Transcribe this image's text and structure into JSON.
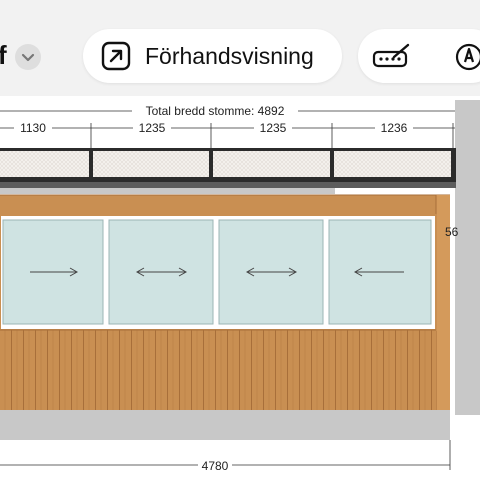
{
  "toolbar": {
    "file_name_fragment": "f",
    "preview_label": "Förhandsvisning"
  },
  "drawing": {
    "total_label": "Total bredd stomme: 4892",
    "segments": [
      "1130",
      "1235",
      "1235",
      "1236"
    ],
    "side_dimension": "56",
    "bottom_dimension": "4780",
    "colors": {
      "wood": "#c98f52",
      "wood_dark": "#a86f3a",
      "glass": "#cfe3e2",
      "frame": "#2b2b2b",
      "grey_panel": "#c8c8c8"
    }
  }
}
